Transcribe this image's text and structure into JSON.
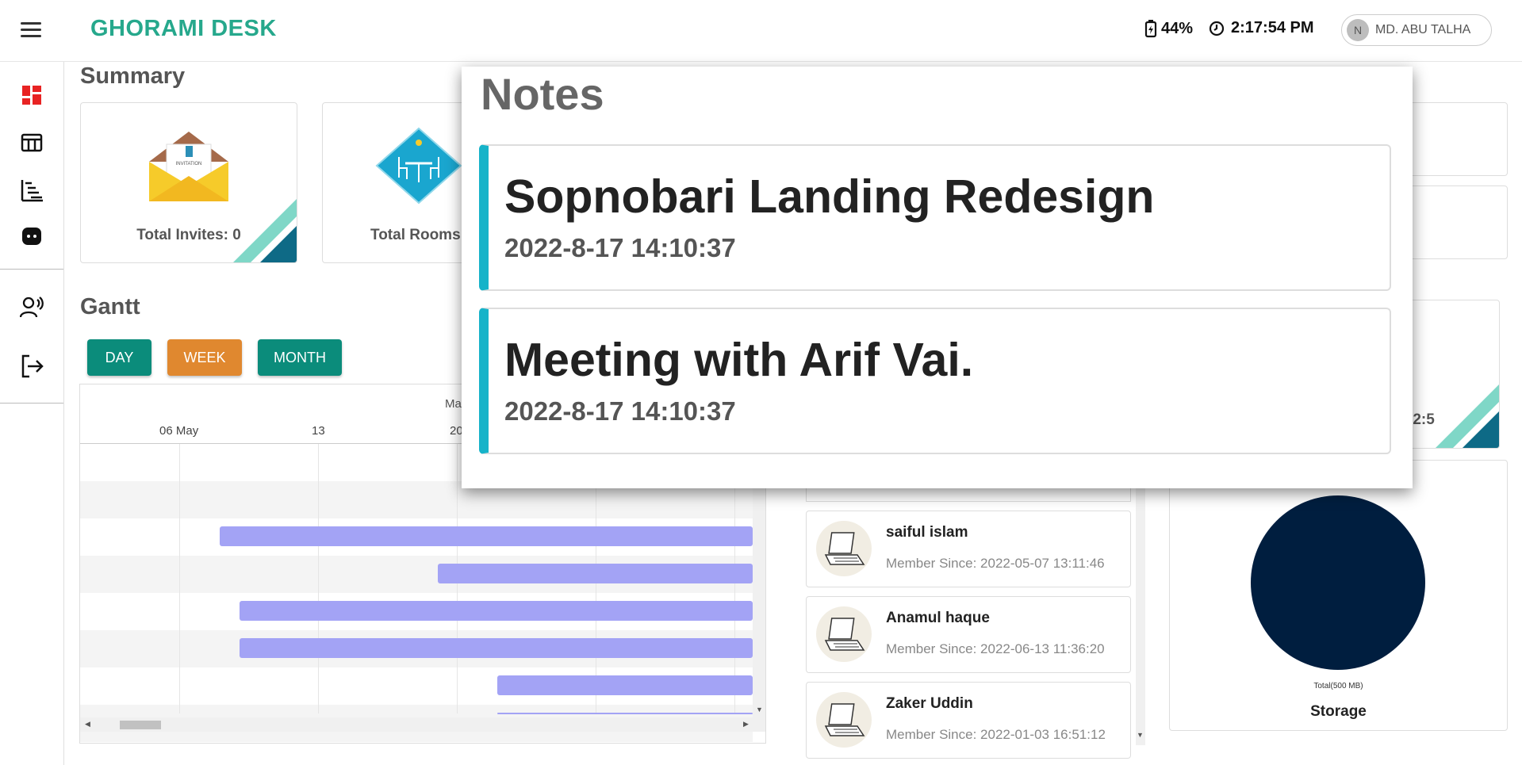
{
  "header": {
    "brand": "GHORAMI DESK",
    "battery": "44%",
    "time": "2:17:54 PM",
    "user_initial": "N",
    "user_name": "MD. ABU TALHA"
  },
  "sidebar": {
    "items": [
      "dashboard-icon",
      "table-icon",
      "gantt-icon",
      "chat-icon",
      "team-icon",
      "logout-icon"
    ]
  },
  "summary": {
    "title": "Summary",
    "invites_label": "Total Invites: 0",
    "invite_card_text": "INVITATION",
    "rooms_label": "Total Rooms",
    "partial_time": ":2:5"
  },
  "gantt": {
    "title": "Gantt",
    "buttons": {
      "day": "DAY",
      "week": "WEEK",
      "month": "MONTH"
    },
    "month_label": "Ma",
    "ticks": [
      "06 May",
      "13",
      "20"
    ]
  },
  "members": [
    {
      "name": "saiful islam",
      "since": "Member Since: 2022-05-07 13:11:46"
    },
    {
      "name": "Anamul haque",
      "since": "Member Since: 2022-06-13 11:36:20"
    },
    {
      "name": "Zaker Uddin",
      "since": "Member Since: 2022-01-03 16:51:12"
    }
  ],
  "storage": {
    "total": "Total(500 MB)",
    "label": "Storage",
    "color": "#001e3f"
  },
  "notes": {
    "title": "Notes",
    "items": [
      {
        "title": "Sopnobari Landing Redesign",
        "date": "2022-8-17 14:10:37"
      },
      {
        "title": "Meeting with Arif Vai.",
        "date": "2022-8-17 14:10:37"
      }
    ]
  },
  "colors": {
    "brand": "#26a88c",
    "teal_button": "#0b8c7b",
    "orange_button": "#e0882f",
    "note_accent": "#16b3c9",
    "gantt_bar": "#a3a3f5"
  }
}
